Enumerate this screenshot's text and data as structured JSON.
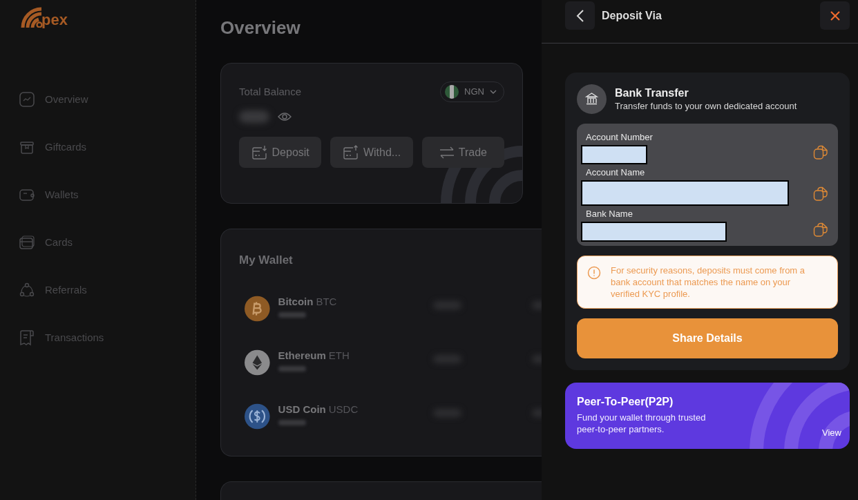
{
  "logo": {
    "text": "pex"
  },
  "sidebar": {
    "items": [
      {
        "label": "Overview",
        "kind": "chart",
        "selected": false
      },
      {
        "label": "Giftcards",
        "kind": "gift",
        "selected": false
      },
      {
        "label": "Wallets",
        "kind": "wallet",
        "selected": false
      },
      {
        "label": "Cards",
        "kind": "card",
        "selected": false
      },
      {
        "label": "Referrals",
        "kind": "referral",
        "selected": false
      },
      {
        "label": "Transactions",
        "kind": "receipt",
        "selected": false
      }
    ]
  },
  "page_title": "Overview",
  "balance_card": {
    "label": "Total Balance",
    "currency": "NGN",
    "actions": [
      {
        "label": "Deposit",
        "kind": "deposit"
      },
      {
        "label": "Withd...",
        "kind": "withdraw"
      },
      {
        "label": "Trade",
        "kind": "trade"
      }
    ]
  },
  "wallet_card": {
    "title": "My Wallet",
    "coins": [
      {
        "name": "Bitcoin",
        "symbol": "BTC",
        "kind": "bitcoin"
      },
      {
        "name": "Ethereum",
        "symbol": "ETH",
        "kind": "ethereum"
      },
      {
        "name": "USD Coin",
        "symbol": "USDC",
        "kind": "usdc"
      }
    ]
  },
  "drawer": {
    "title": "Deposit Via",
    "bank_transfer": {
      "title": "Bank Transfer",
      "subtitle": "Transfer funds to your own dedicated account",
      "fields": [
        {
          "label": "Account Number"
        },
        {
          "label": "Account Name"
        },
        {
          "label": "Bank Name"
        }
      ],
      "notice": "For security reasons, deposits must come from a bank account that matches the name on your verified KYC profile.",
      "button": "Share Details"
    },
    "p2p": {
      "title": "Peer-To-Peer(P2P)",
      "description": "Fund your wallet through trusted peer-to-peer partners.",
      "link": "View"
    }
  }
}
